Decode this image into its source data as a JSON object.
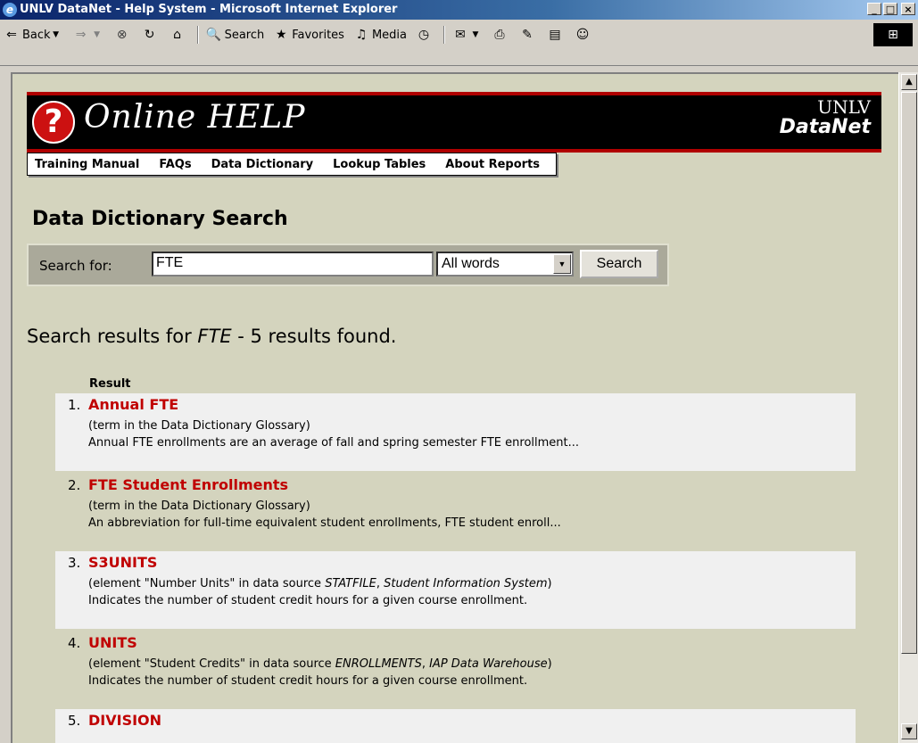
{
  "window": {
    "title": "UNLV DataNet - Help System - Microsoft Internet Explorer",
    "controls": [
      "_",
      "□",
      "×"
    ]
  },
  "toolbar": {
    "back": "Back",
    "search": "Search",
    "favorites": "Favorites",
    "media": "Media"
  },
  "banner": {
    "title": "Online HELP",
    "logo_top": "UNLV",
    "logo_bottom": "DataNet"
  },
  "nav": [
    "Training Manual",
    "FAQs",
    "Data Dictionary",
    "Lookup Tables",
    "About Reports"
  ],
  "page": {
    "title": "Data Dictionary Search"
  },
  "search": {
    "label": "Search for:",
    "value": "FTE",
    "mode": "All words",
    "button": "Search"
  },
  "results": {
    "prefix": "Search results for ",
    "term": "FTE",
    "suffix": " - 5 results found.",
    "column_header": "Result",
    "items": [
      {
        "number": "1.",
        "title": "Annual FTE",
        "source": [
          "(term in the Data Dictionary Glossary)"
        ],
        "description": "Annual FTE enrollments are an average of fall and spring semester FTE enrollment..."
      },
      {
        "number": "2.",
        "title": "FTE Student Enrollments",
        "source": [
          "(term in the Data Dictionary Glossary)"
        ],
        "description": "An abbreviation for full-time equivalent student enrollments, FTE student enroll..."
      },
      {
        "number": "3.",
        "title": "S3UNITS",
        "source": [
          "(element \"Number Units\" in data source ",
          "STATFILE",
          ", ",
          "Student Information System",
          ")"
        ],
        "description": "Indicates the number of student credit hours for a given course enrollment."
      },
      {
        "number": "4.",
        "title": "UNITS",
        "source": [
          "(element \"Student Credits\" in data source ",
          "ENROLLMENTS",
          ", ",
          "IAP Data Warehouse",
          ")"
        ],
        "description": "Indicates the number of student credit hours for a given course enrollment."
      },
      {
        "number": "5.",
        "title": "DIVISION",
        "source": [
          ""
        ],
        "description": ""
      }
    ]
  }
}
